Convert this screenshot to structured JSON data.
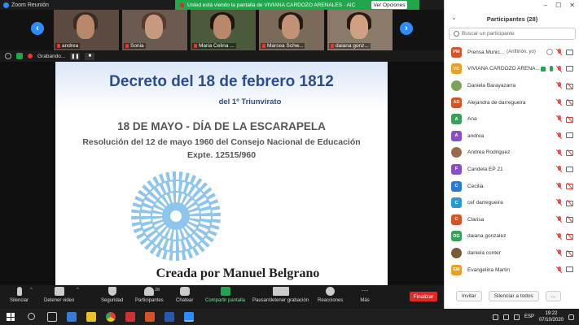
{
  "window": {
    "title": "Zoom Reunión"
  },
  "share_banner": {
    "text": "Usted está viendo la pantalla de VIVIANA CARDOZO ARENALES · AIC",
    "view_options": "Ver Opciones"
  },
  "thumbnails": [
    {
      "name": "andrea"
    },
    {
      "name": "Sonia"
    },
    {
      "name": "Maria Celina ..."
    },
    {
      "name": "Marcea Schw..."
    },
    {
      "name": "daiana gonz..."
    }
  ],
  "recording": {
    "label": "Grabando..."
  },
  "slide": {
    "title": "Decreto del 18 de febrero 1812",
    "subtitle": "del 1º Triunvirato",
    "heading": "18 DE MAYO -  DÍA DE LA ESCARAPELA",
    "resolution_line1": "Resolución del 12 de mayo 1960 del Consejo Nacional de Educación",
    "resolution_line2": "Expte. 12515/960",
    "creator": "Creada por Manuel Belgrano",
    "colors": {
      "title": "#2c4c8f",
      "cockade_blue": "#8ec5ec",
      "cockade_white": "#ffffff"
    }
  },
  "toolbar": {
    "mute": "Silenciar",
    "stop_video": "Detener video",
    "security": "Seguridad",
    "participants": "Participantes",
    "participants_count": "28",
    "chat": "Chatear",
    "share": "Compartir pantalla",
    "pause_record": "Pausar/detener grabación",
    "reactions": "Reacciones",
    "more": "Más",
    "end": "Finalizar"
  },
  "panel": {
    "title": "Participantes (28)",
    "search_placeholder": "Buscar un participante",
    "participants": [
      {
        "initials": "PM",
        "color": "#d4542a",
        "name": "Prensa Munic...",
        "note": "(Anfitrión, yo)"
      },
      {
        "initials": "VC",
        "color": "#e8a02a",
        "name": "VIVIANA CARDOZO ARENA...",
        "note": ""
      },
      {
        "initials": "",
        "color": "#7aa35a",
        "name": "Daniela Barayazarra",
        "note": ""
      },
      {
        "initials": "AD",
        "color": "#d4542a",
        "name": "Alejandra  de darregueira",
        "note": ""
      },
      {
        "initials": "A",
        "color": "#37a05a",
        "name": "Ana",
        "note": ""
      },
      {
        "initials": "A",
        "color": "#8a4fc0",
        "name": "andrea",
        "note": ""
      },
      {
        "initials": "",
        "color": "#9a6a4a",
        "name": "Andrea Rodriguez",
        "note": ""
      },
      {
        "initials": "F",
        "color": "#8a4fc0",
        "name": "Candela EP 21",
        "note": ""
      },
      {
        "initials": "C",
        "color": "#2a7ad4",
        "name": "Cecilia",
        "note": ""
      },
      {
        "initials": "C",
        "color": "#2a9ad4",
        "name": "cef darregueira",
        "note": ""
      },
      {
        "initials": "C",
        "color": "#d4542a",
        "name": "Clarisa",
        "note": ""
      },
      {
        "initials": "DG",
        "color": "#37a05a",
        "name": "daiana gonzalez",
        "note": ""
      },
      {
        "initials": "",
        "color": "#7a5a3a",
        "name": "daniela conter",
        "note": ""
      },
      {
        "initials": "EM",
        "color": "#e8a02a",
        "name": "Evangelina Martin",
        "note": ""
      }
    ],
    "invite": "Invitar",
    "mute_all": "Silenciar a todos",
    "more": "..."
  },
  "taskbar": {
    "language": "ESP",
    "time": "19:22",
    "date": "07/10/2020"
  }
}
